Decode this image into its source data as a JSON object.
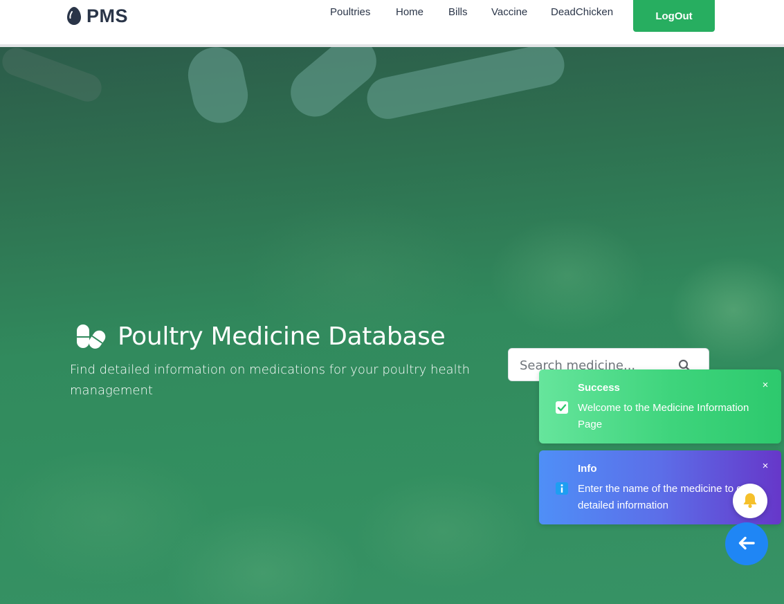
{
  "brand": {
    "name": "PMS",
    "icon": "egg-icon"
  },
  "nav": {
    "links": [
      "Poultries",
      "Home",
      "Bills",
      "Vaccine",
      "DeadChicken"
    ],
    "logout_label": "LogOut"
  },
  "hero": {
    "icon": "pills-icon",
    "title": "Poultry Medicine Database",
    "subtitle": "Find detailed information on medications for your poultry health management"
  },
  "search": {
    "placeholder": "Search medicine...",
    "value": "",
    "icon": "search-icon"
  },
  "toasts": [
    {
      "type": "success",
      "title": "Success",
      "message": "Welcome to the Medicine Information Page",
      "icon": "check-square-icon",
      "close": "×"
    },
    {
      "type": "info",
      "title": "Info",
      "message": "Enter the name of the medicine to get detailed information",
      "icon": "info-icon",
      "close": "×"
    }
  ],
  "floating": {
    "bell_icon": "bell-icon",
    "back_icon": "arrow-left-icon"
  },
  "colors": {
    "brand_dark": "#2a3548",
    "logout_green": "#27ae60",
    "hero_green": "#318a5d",
    "success_green": "#3ed47c",
    "info_blue": "#4f8ff7",
    "info_purple": "#6637c9",
    "back_blue": "#1f86f5",
    "bell_yellow": "#f5c02b"
  }
}
